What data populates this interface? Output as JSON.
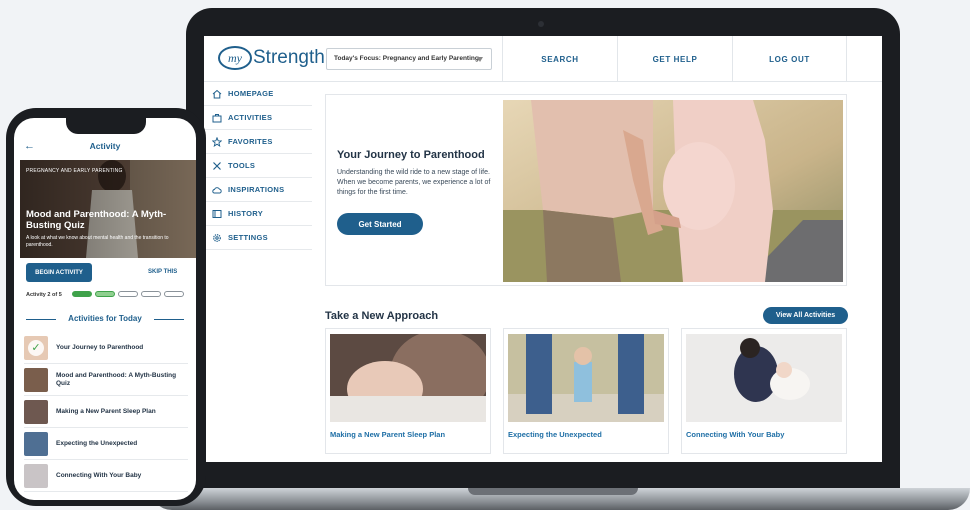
{
  "laptop": {
    "logo": {
      "my": "my",
      "word": "Strength"
    },
    "focus": {
      "label": "Today's Focus: Pregnancy and Early Parenting"
    },
    "nav_top": [
      "SEARCH",
      "GET HELP",
      "LOG OUT"
    ],
    "sidebar": [
      {
        "label": "HOMEPAGE",
        "icon": "home-icon"
      },
      {
        "label": "ACTIVITIES",
        "icon": "briefcase-icon"
      },
      {
        "label": "FAVORITES",
        "icon": "star-icon"
      },
      {
        "label": "TOOLS",
        "icon": "tools-icon"
      },
      {
        "label": "INSPIRATIONS",
        "icon": "cloud-icon"
      },
      {
        "label": "HISTORY",
        "icon": "history-icon"
      },
      {
        "label": "SETTINGS",
        "icon": "gear-icon"
      }
    ],
    "hero": {
      "title": "Your Journey to Parenthood",
      "body": "Understanding the wild ride to a new stage of life. When we become parents, we experience a lot of things for the first time.",
      "button": "Get Started"
    },
    "section": {
      "title": "Take a New Approach",
      "button": "View All Activities"
    },
    "cards": [
      "Making a New Parent Sleep Plan",
      "Expecting the Unexpected",
      "Connecting With Your Baby"
    ]
  },
  "phone": {
    "header": {
      "back": "←",
      "title": "Activity"
    },
    "banner": {
      "tag": "PREGNANCY AND EARLY PARENTING",
      "title": "Mood and Parenthood: A Myth-Busting Quiz",
      "subtitle": "A look at what we know about mental health and the transition to parenthood."
    },
    "begin": "BEGIN ACTIVITY",
    "skip": "SKIP THIS",
    "progress": "Activity 2 of 5",
    "progress_value": {
      "current": 2,
      "total": 5
    },
    "today_title": "Activities for Today",
    "items": [
      "Your Journey to Parenthood",
      "Mood and Parenthood: A Myth-Busting Quiz",
      "Making a New Parent Sleep Plan",
      "Expecting the Unexpected",
      "Connecting With Your Baby"
    ]
  },
  "colors": {
    "brand": "#1f5f8c",
    "link": "#1f6fa6",
    "progress": "#3fa24a"
  }
}
